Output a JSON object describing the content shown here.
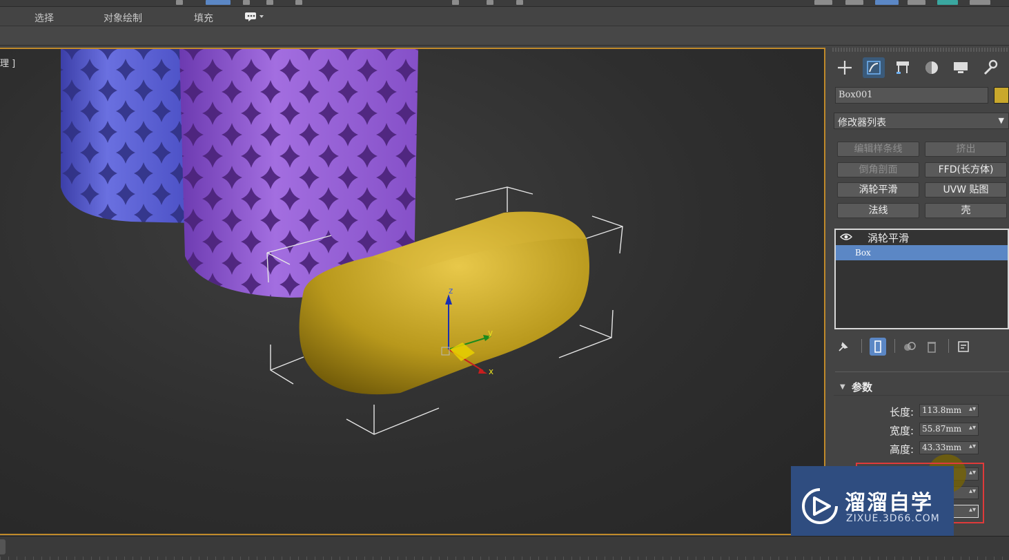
{
  "menu": {
    "items": [
      "选择",
      "对象绘制",
      "填充"
    ],
    "dropdown_icon": "speech-bubble-icon"
  },
  "viewport": {
    "label": "理 ]",
    "axes": {
      "x": "x",
      "y": "y",
      "z": "z"
    }
  },
  "command_panel": {
    "tabs": [
      "create-icon",
      "modify-icon",
      "hierarchy-icon",
      "motion-icon",
      "display-icon",
      "utilities-icon"
    ],
    "object_name": "Box001",
    "object_color": "#c9a82c",
    "modifier_list": "修改器列表",
    "modifier_buttons": [
      {
        "label": "编辑样条线",
        "enabled": false
      },
      {
        "label": "挤出",
        "enabled": false
      },
      {
        "label": "倒角剖面",
        "enabled": false
      },
      {
        "label": "FFD(长方体)",
        "enabled": true
      },
      {
        "label": "涡轮平滑",
        "enabled": true
      },
      {
        "label": "UVW 贴图",
        "enabled": true
      },
      {
        "label": "法线",
        "enabled": true
      },
      {
        "label": "壳",
        "enabled": true
      }
    ],
    "stack": {
      "modifier": "涡轮平滑",
      "base": "Box"
    },
    "rollout_title": "参数",
    "params": [
      {
        "label": "长度:",
        "value": "113.8mm"
      },
      {
        "label": "宽度:",
        "value": "55.87mm"
      },
      {
        "label": "高度:",
        "value": "43.33mm"
      }
    ]
  },
  "watermark": {
    "brand": "溜溜自学",
    "site": "ZIXUE.3D66.COM"
  }
}
